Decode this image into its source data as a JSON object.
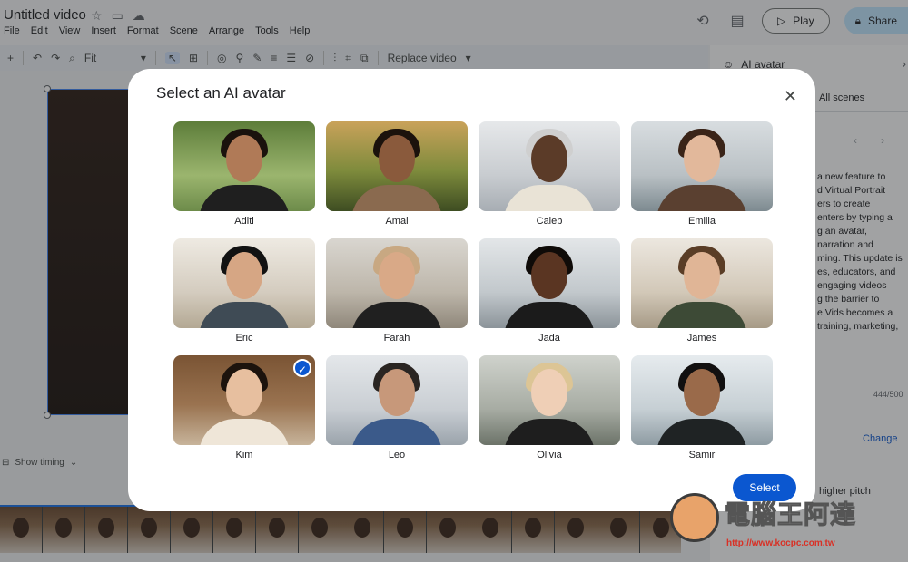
{
  "app": {
    "doc_title": "Untitled video",
    "menu": [
      "File",
      "Edit",
      "View",
      "Insert",
      "Format",
      "Scene",
      "Arrange",
      "Tools",
      "Help"
    ],
    "play_label": "Play",
    "share_label": "Share"
  },
  "toolbar": {
    "zoom_label": "Fit",
    "replace_label": "Replace video"
  },
  "canvas": {
    "show_timing_label": "Show timing"
  },
  "side_panel": {
    "title": "AI avatar",
    "tab_all_scenes": "All scenes",
    "description": "a new feature to\nd Virtual Portrait\ners to create\nenters by typing a\ng an avatar,\nnarration and\nming. This update is\nes, educators, and\n engaging videos\ng the barrier to\ne Vids becomes a\n training, marketing,",
    "char_count": "444/500",
    "change_label": "Change",
    "pitch_label": "higher pitch"
  },
  "dialog": {
    "title": "Select an AI avatar",
    "select_label": "Select",
    "avatars": [
      {
        "name": "Aditi",
        "selected": false
      },
      {
        "name": "Amal",
        "selected": false
      },
      {
        "name": "Caleb",
        "selected": false
      },
      {
        "name": "Emilia",
        "selected": false
      },
      {
        "name": "Eric",
        "selected": false
      },
      {
        "name": "Farah",
        "selected": false
      },
      {
        "name": "Jada",
        "selected": false
      },
      {
        "name": "James",
        "selected": false
      },
      {
        "name": "Kim",
        "selected": true
      },
      {
        "name": "Leo",
        "selected": false
      },
      {
        "name": "Olivia",
        "selected": false
      },
      {
        "name": "Samir",
        "selected": false
      }
    ]
  },
  "watermark": {
    "text": "電腦王阿達",
    "url": "http://www.kocpc.com.tw"
  },
  "colors": {
    "accent": "#0b57d0",
    "share_bg": "#c2e7ff"
  }
}
